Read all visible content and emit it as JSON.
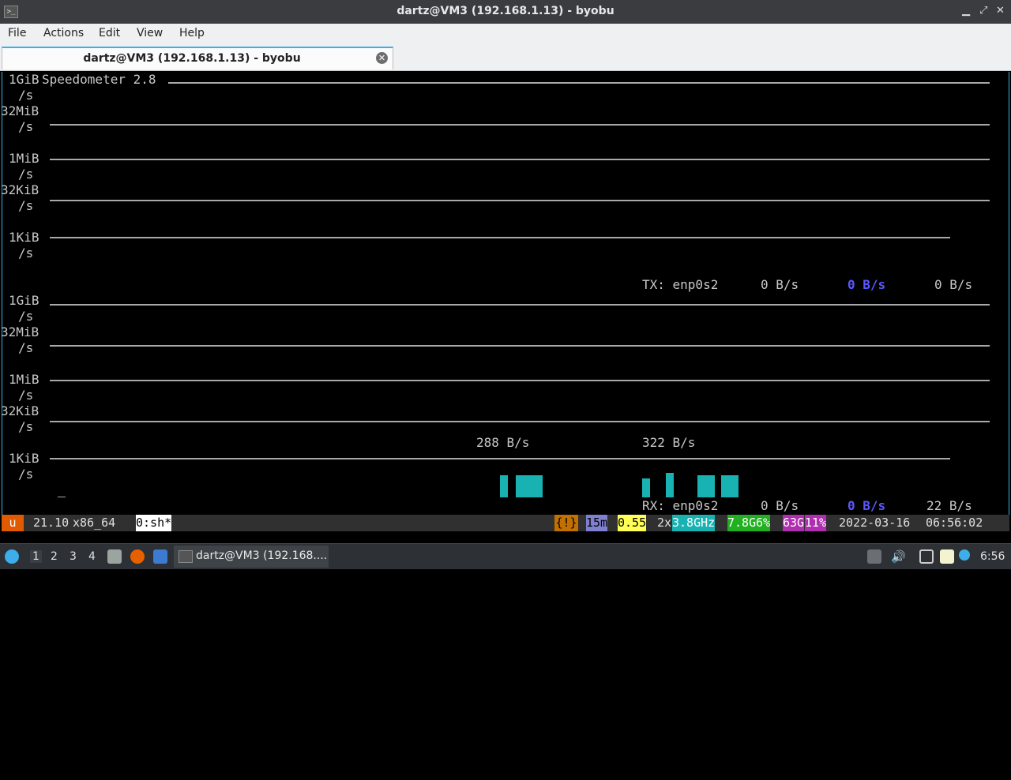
{
  "window": {
    "title": "dartz@VM3 (192.168.1.13) - byobu",
    "min": "▁",
    "max": "⤢",
    "close": "✕"
  },
  "menu": {
    "file": "File",
    "actions": "Actions",
    "edit": "Edit",
    "view": "View",
    "help": "Help"
  },
  "tab": {
    "label": "dartz@VM3 (192.168.1.13) - byobu",
    "close": "✕"
  },
  "speedometer": {
    "title": "Speedometer 2.8",
    "tx_section": {
      "y_labels": [
        "1GiB",
        "/s",
        "32MiB",
        "/s",
        "1MiB",
        "/s",
        "32KiB",
        "/s",
        "1KiB",
        "/s"
      ],
      "interface_line": "TX: enp0s2",
      "rate_current": "0 B/s",
      "rate_avg": "0 B/s",
      "rate_total": "0 B/s"
    },
    "rx_section": {
      "y_labels": [
        "1GiB",
        "/s",
        "32MiB",
        "/s",
        "1MiB",
        "/s",
        "32KiB",
        "/s",
        "1KiB",
        "/s"
      ],
      "peak_left": "288 B/s",
      "peak_right": "322 B/s",
      "interface_line": "RX: enp0s2",
      "rate_current": "0 B/s",
      "rate_avg": "0 B/s",
      "rate_total": "22 B/s"
    },
    "colors": {
      "graph_bar": "#19b2b2",
      "avg_rate": "#5858ff"
    }
  },
  "status": {
    "logo": "u",
    "release": "21.10",
    "arch": "x86_64",
    "window": "0:sh*",
    "alert": "{!}",
    "uptime": "15m",
    "load": "0.55",
    "cpu_count": "2x",
    "cpu_freq": "3.8GHz",
    "mem_total": "7.8G",
    "mem_pct": "6%",
    "disk_total": "63G",
    "disk_pct": "11%",
    "date": "2022-03-16",
    "time": "06:56:02"
  },
  "taskbar": {
    "workspaces": [
      "1",
      "2",
      "3",
      "4"
    ],
    "task_label": "dartz@VM3 (192.168....",
    "clock": "6:56",
    "icons": [
      "start-menu-icon",
      "file-manager-icon",
      "firefox-icon",
      "desktop-icon",
      "terminal-icon",
      "tray-up-icon",
      "volume-icon",
      "display-icon",
      "clipboard-icon",
      "update-icon"
    ]
  }
}
